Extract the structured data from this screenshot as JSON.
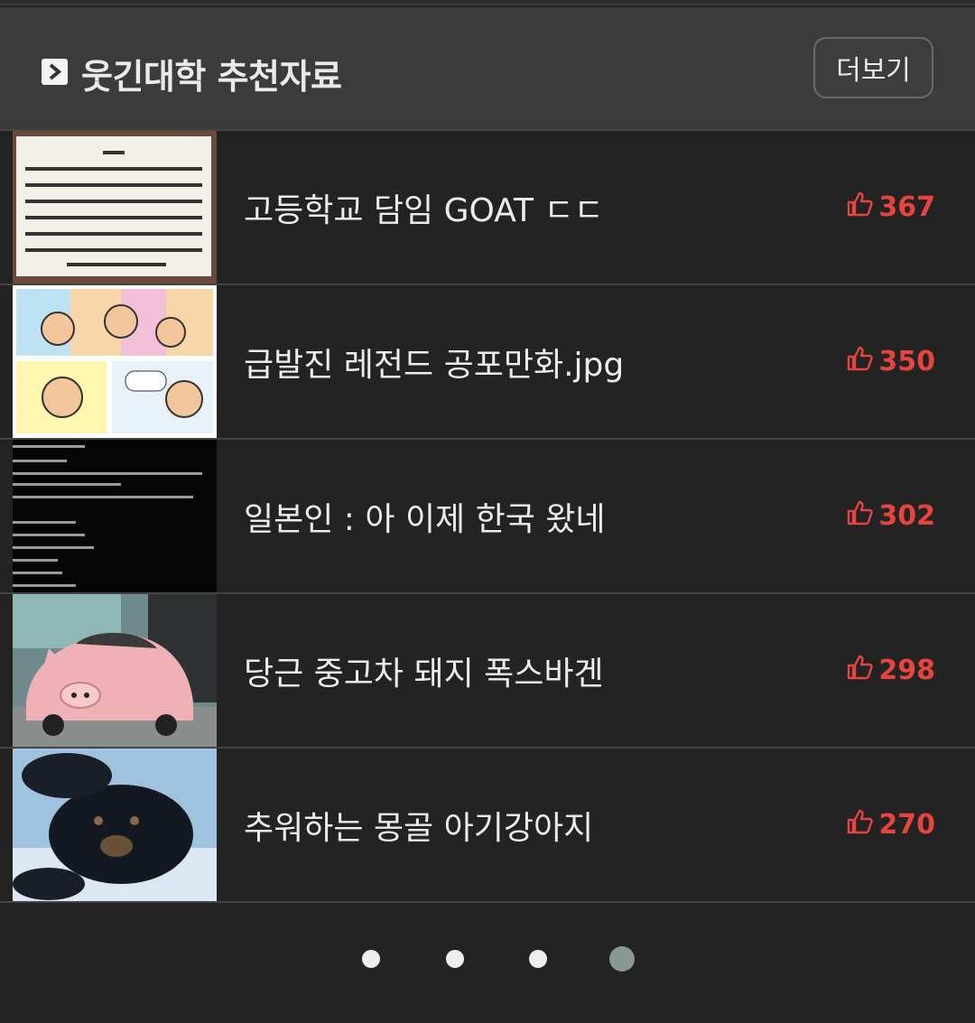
{
  "header": {
    "title": "웃긴대학 추천자료",
    "more_label": "더보기"
  },
  "items": [
    {
      "title": "고등학교 담임 GOAT ㄷㄷ",
      "likes": "367",
      "thumb": "notice-board"
    },
    {
      "title": "급발진 레전드 공포만화.jpg",
      "likes": "350",
      "thumb": "comic"
    },
    {
      "title": "일본인 : 아 이제 한국 왔네",
      "likes": "302",
      "thumb": "dark-text-post"
    },
    {
      "title": "당근 중고차 돼지 폭스바겐",
      "likes": "298",
      "thumb": "pink-pig-car"
    },
    {
      "title": "추워하는 몽골 아기강아지",
      "likes": "270",
      "thumb": "black-puppy"
    }
  ],
  "pagination": {
    "total": 4,
    "active": 4
  },
  "colors": {
    "accent": "#e5453e",
    "active_dot": "#8a9896",
    "background": "#232323"
  }
}
